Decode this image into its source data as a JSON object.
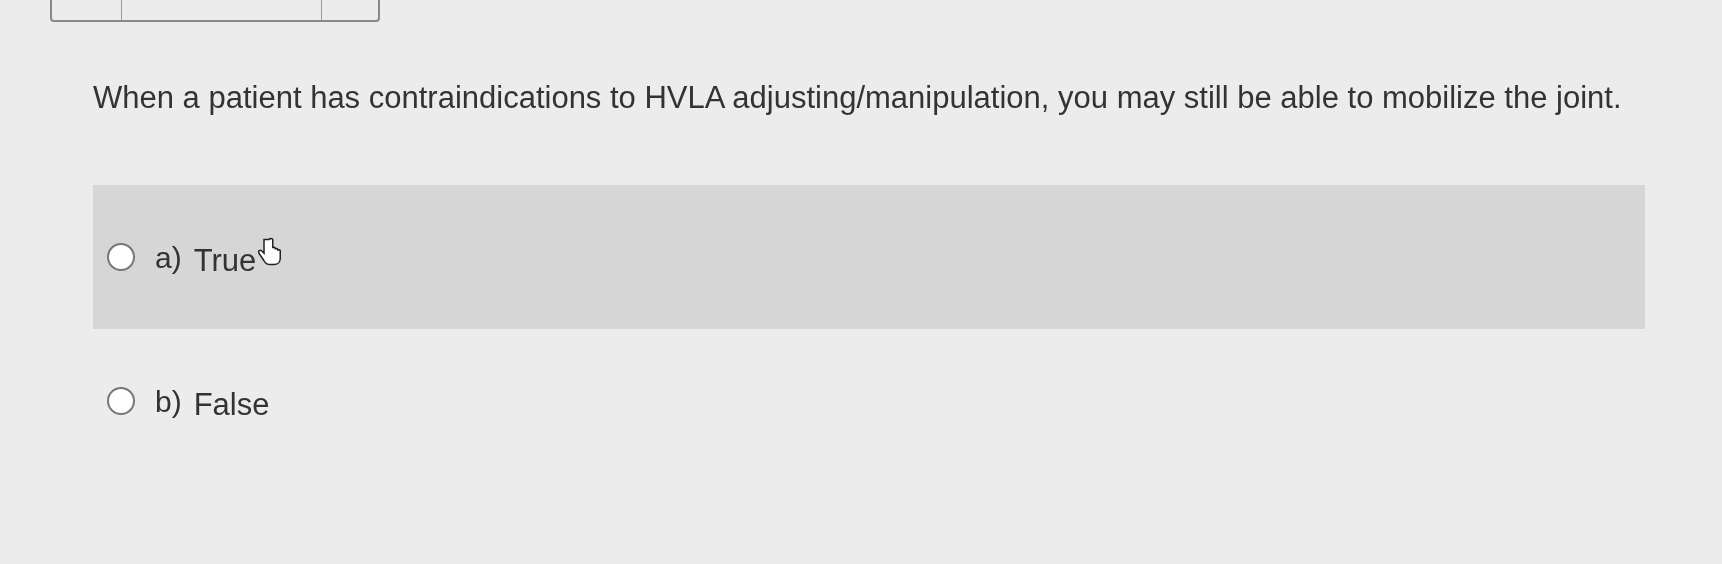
{
  "question": {
    "text": "When a patient has contraindications to HVLA adjusting/manipulation, you may still be able to mobilize the joint."
  },
  "options": [
    {
      "letter": "a)",
      "label": "True",
      "selected": false,
      "highlighted": true
    },
    {
      "letter": "b)",
      "label": "False",
      "selected": false,
      "highlighted": false
    }
  ]
}
